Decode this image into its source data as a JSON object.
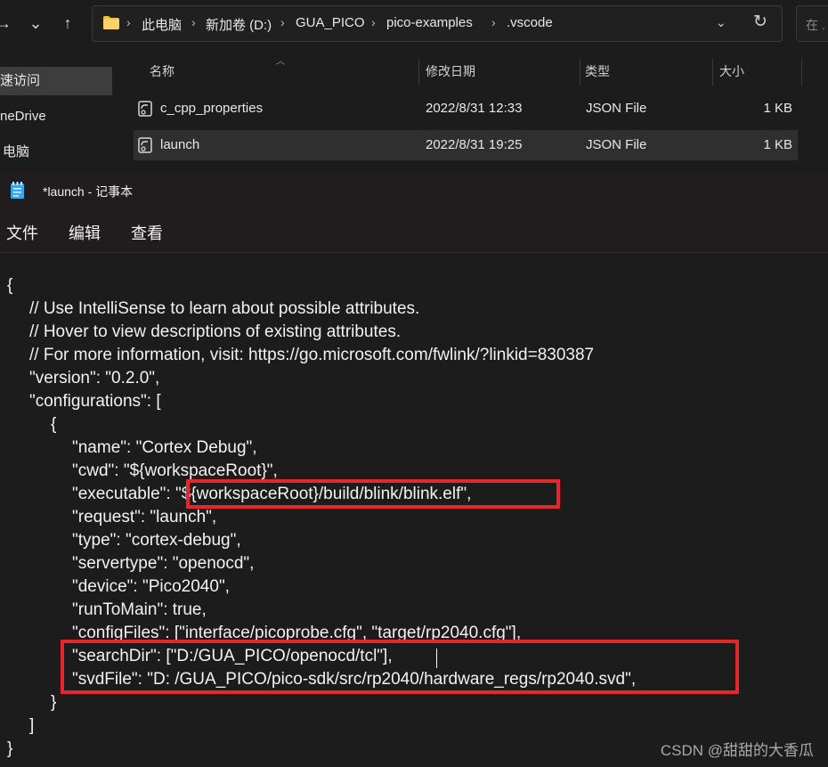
{
  "explorer": {
    "nav": {
      "back": "→",
      "recent": "⌄",
      "up": "↑"
    },
    "address": {
      "crumbs": [
        "此电脑",
        "新加卷 (D:)",
        "GUA_PICO",
        "pico-examples",
        ".vscode"
      ],
      "separator": "›",
      "dropdown_glyph": "⌄",
      "refresh_glyph": "↻"
    },
    "search": {
      "placeholder": "在 ."
    },
    "nav_pane": [
      {
        "label": "速访问"
      },
      {
        "label": "neDrive"
      },
      {
        "label": "电脑"
      }
    ],
    "columns": {
      "name": "名称",
      "date": "修改日期",
      "type": "类型",
      "size": "大小"
    },
    "files": [
      {
        "name": "c_cpp_properties",
        "date": "2022/8/31 12:33",
        "type": "JSON File",
        "size": "1 KB"
      },
      {
        "name": "launch",
        "date": "2022/8/31 19:25",
        "type": "JSON File",
        "size": "1 KB"
      }
    ]
  },
  "notepad": {
    "title": "*launch - 记事本",
    "menu": [
      "文件",
      "编辑",
      "查看"
    ],
    "lines": [
      "{",
      "// Use IntelliSense to learn about possible attributes.",
      "// Hover to view descriptions of existing attributes.",
      "// For more information, visit: https://go.microsoft.com/fwlink/?linkid=830387",
      "\"version\": \"0.2.0\",",
      "\"configurations\": [",
      "{",
      "\"name\": \"Cortex Debug\",",
      "\"cwd\": \"${workspaceRoot}\",",
      "\"executable\": \"${workspaceRoot}/build/blink/blink.elf\",",
      "\"request\": \"launch\",",
      "\"type\": \"cortex-debug\",",
      "\"servertype\": \"openocd\",",
      "\"device\": \"Pico2040\",",
      "\"runToMain\": true,",
      "\"configFiles\": [\"interface/picoprobe.cfg\", \"target/rp2040.cfg\"],",
      "\"searchDir\": [\"D:/GUA_PICO/openocd/tcl\"],",
      "\"svdFile\": \"D: /GUA_PICO/pico-sdk/src/rp2040/hardware_regs/rp2040.svd\",",
      "}",
      "]",
      "}"
    ],
    "highlight_color": "#e5262a"
  },
  "watermark": "CSDN @甜甜的大香瓜"
}
